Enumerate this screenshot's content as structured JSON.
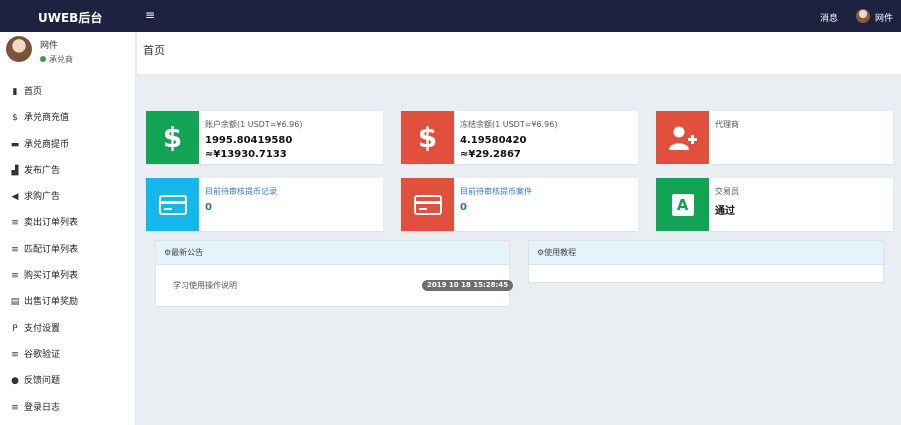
{
  "topbar": {
    "brand": "UWEB后台",
    "menu_toggle": "≡",
    "messages": "消息",
    "user": "网件"
  },
  "sidebar": {
    "user_name": "网件",
    "user_status": "承兑商",
    "items": [
      {
        "icon": "bar-chart-icon",
        "glyph": "▮",
        "label": "首页"
      },
      {
        "icon": "dollar-icon",
        "glyph": "$",
        "label": "承兑商充值"
      },
      {
        "icon": "credit-card-icon",
        "glyph": "▬",
        "label": "承兑商提币"
      },
      {
        "icon": "signal-icon",
        "glyph": "▟",
        "label": "发布广告"
      },
      {
        "icon": "megaphone-icon",
        "glyph": "◀",
        "label": "求购广告"
      },
      {
        "icon": "list-icon",
        "glyph": "≡",
        "label": "卖出订单列表"
      },
      {
        "icon": "list-icon",
        "glyph": "≡",
        "label": "匹配订单列表"
      },
      {
        "icon": "list-icon",
        "glyph": "≡",
        "label": "购买订单列表"
      },
      {
        "icon": "id-card-icon",
        "glyph": "▤",
        "label": "出售订单奖励"
      },
      {
        "icon": "paypal-icon",
        "glyph": "P",
        "label": "支付设置"
      },
      {
        "icon": "list-icon",
        "glyph": "≡",
        "label": "谷歌验证"
      },
      {
        "icon": "comment-icon",
        "glyph": "●",
        "label": "反馈问题"
      },
      {
        "icon": "list-icon",
        "glyph": "≡",
        "label": "登录日志"
      }
    ]
  },
  "main": {
    "crumb": "首页"
  },
  "cards": {
    "account_balance": {
      "label": "账户余额(1 USDT=¥6.96)",
      "value": "1995.80419580",
      "value_cny": "≈¥13930.7133"
    },
    "frozen_balance": {
      "label": "冻结余额(1 USDT=¥6.96)",
      "value": "4.19580420",
      "value_cny": "≈¥29.2867"
    },
    "agent": {
      "label": "代理商"
    },
    "pending_recharge": {
      "label": "目前待审核提币记录",
      "value": "0"
    },
    "pending_withdraw": {
      "label": "目前待审核提币案件",
      "value": "0"
    },
    "trader": {
      "label": "交易员",
      "value": "通过"
    }
  },
  "panels": {
    "notice_title": "最新公告",
    "notice_item": "学习使用操作说明",
    "notice_date": "2019 10 18 15:28:45",
    "tutorial_title": "使用教程"
  },
  "colors": {
    "topbar": "#1d2240",
    "green": "#12a455",
    "red": "#e0503c",
    "cyan": "#14b8ea"
  }
}
